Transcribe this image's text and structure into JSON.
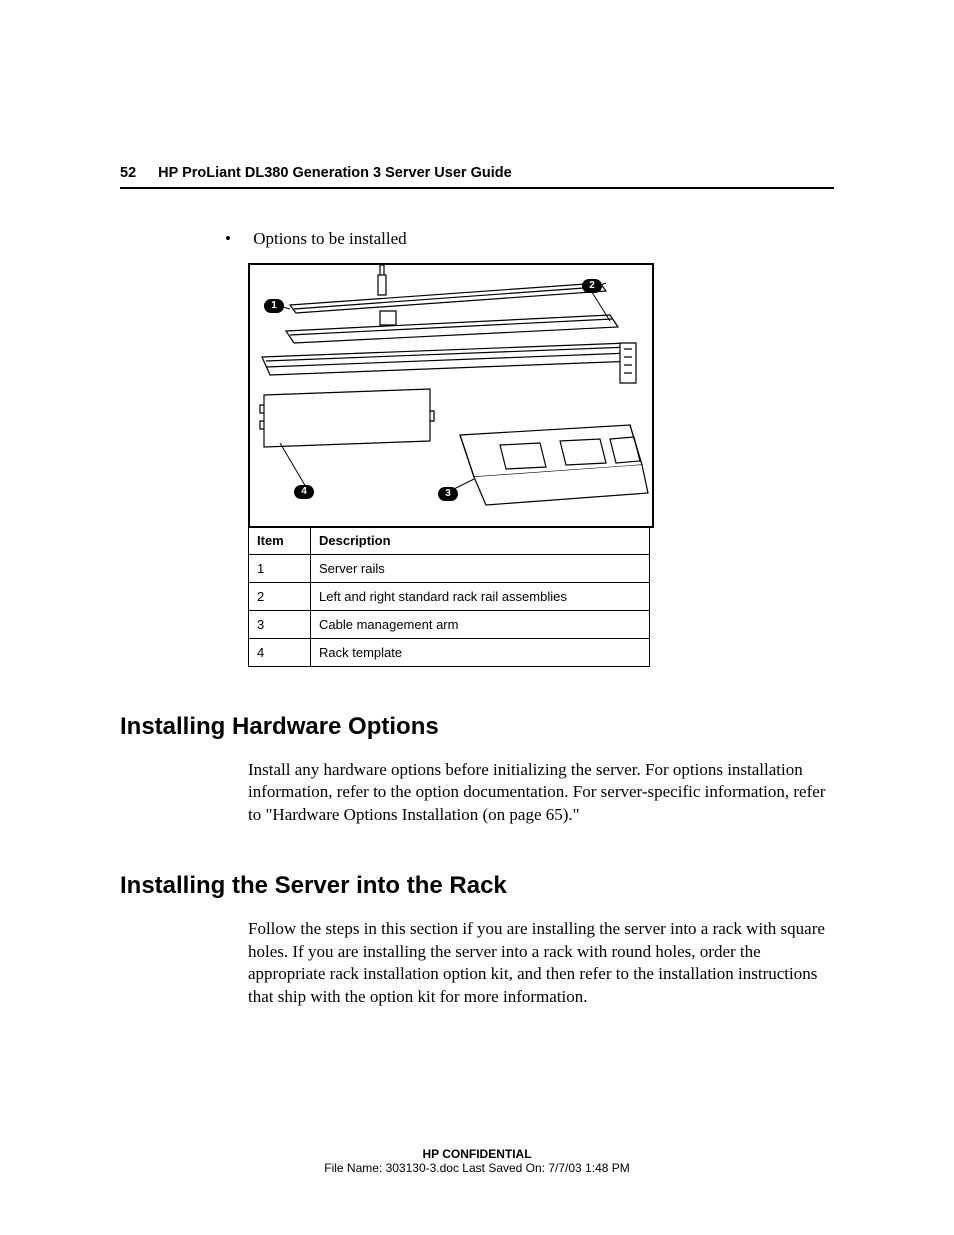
{
  "header": {
    "page_number": "52",
    "doc_title": "HP ProLiant DL380 Generation 3 Server User Guide"
  },
  "bullet": {
    "text": "Options to be installed"
  },
  "figure": {
    "callouts": {
      "c1": "1",
      "c2": "2",
      "c3": "3",
      "c4": "4"
    }
  },
  "table": {
    "headers": {
      "item": "Item",
      "desc": "Description"
    },
    "rows": [
      {
        "item": "1",
        "desc": "Server rails"
      },
      {
        "item": "2",
        "desc": "Left and right standard rack rail assemblies"
      },
      {
        "item": "3",
        "desc": "Cable management arm"
      },
      {
        "item": "4",
        "desc": "Rack template"
      }
    ]
  },
  "sections": {
    "s1": {
      "title": "Installing Hardware Options",
      "para": "Install any hardware options before initializing the server. For options installation information, refer to the option documentation. For server-specific information, refer to \"Hardware Options Installation (on page 65).\""
    },
    "s2": {
      "title": "Installing the Server into the Rack",
      "para": "Follow the steps in this section if you are installing the server into a rack with square holes. If you are installing the server into a rack with round holes, order the appropriate rack installation option kit, and then refer to the installation instructions that ship with the option kit for more information."
    }
  },
  "footer": {
    "confidential": "HP CONFIDENTIAL",
    "fileinfo": "File Name: 303130-3.doc   Last Saved On: 7/7/03 1:48 PM"
  }
}
